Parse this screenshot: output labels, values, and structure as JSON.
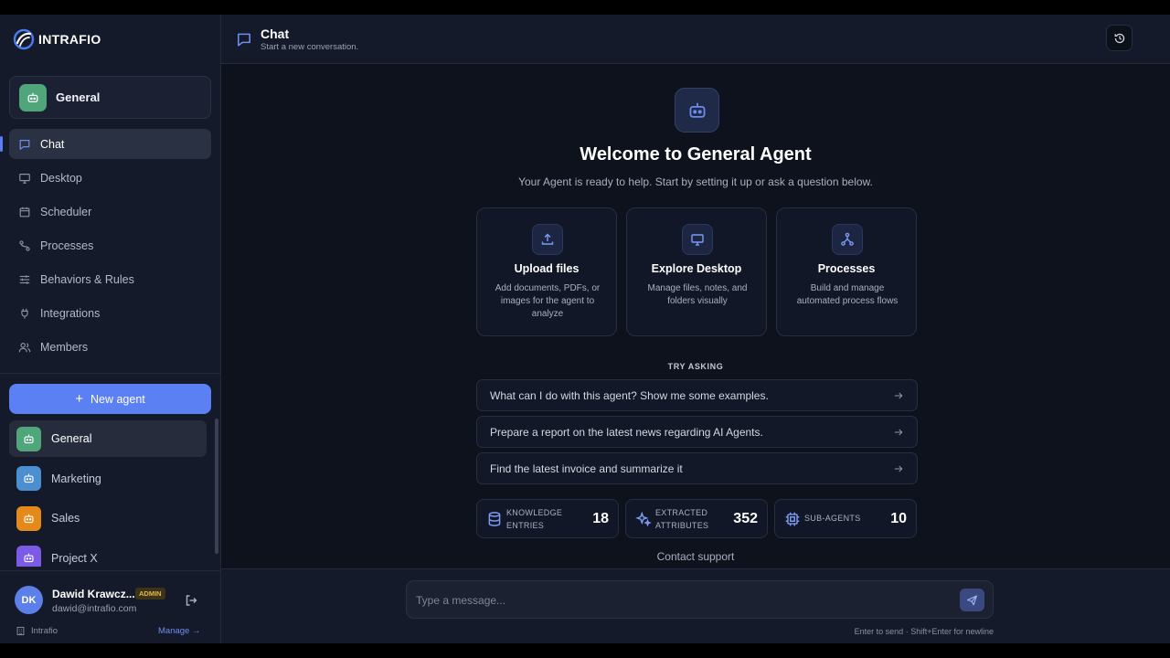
{
  "brand": {
    "name": "INTRAFIO"
  },
  "current_agent": {
    "name": "General"
  },
  "nav": {
    "items": [
      {
        "label": "Chat",
        "icon": "chat-icon",
        "active": true
      },
      {
        "label": "Desktop",
        "icon": "monitor-icon"
      },
      {
        "label": "Scheduler",
        "icon": "calendar-icon"
      },
      {
        "label": "Processes",
        "icon": "workflow-icon"
      },
      {
        "label": "Behaviors & Rules",
        "icon": "sliders-icon"
      },
      {
        "label": "Integrations",
        "icon": "plug-icon"
      },
      {
        "label": "Members",
        "icon": "users-icon"
      }
    ]
  },
  "new_agent_label": "New agent",
  "agents": [
    {
      "name": "General",
      "color": "#4fa67b",
      "active": true
    },
    {
      "name": "Marketing",
      "color": "#4b8fd1"
    },
    {
      "name": "Sales",
      "color": "#e48a1b"
    },
    {
      "name": "Project X",
      "color": "#7b5ae6"
    }
  ],
  "user": {
    "initials": "DK",
    "name": "Dawid Krawcz...",
    "role_badge": "ADMIN",
    "email": "dawid@intrafio.com",
    "org": "Intrafio",
    "manage_label": "Manage →"
  },
  "topbar": {
    "title": "Chat",
    "subtitle": "Start a new conversation."
  },
  "welcome": {
    "title": "Welcome to General Agent",
    "subtitle": "Your Agent is ready to help. Start by setting it up or ask a question below."
  },
  "cards": [
    {
      "title": "Upload files",
      "desc": "Add documents, PDFs, or images for the agent to analyze",
      "icon": "upload-icon"
    },
    {
      "title": "Explore Desktop",
      "desc": "Manage files, notes, and folders visually",
      "icon": "monitor-icon"
    },
    {
      "title": "Processes",
      "desc": "Build and manage automated process flows",
      "icon": "workflow-icon"
    }
  ],
  "try_asking": {
    "heading": "TRY ASKING",
    "items": [
      "What can I do with this agent? Show me some examples.",
      "Prepare a report on the latest news regarding AI Agents.",
      "Find the latest invoice and summarize it"
    ]
  },
  "stats": [
    {
      "label": "KNOWLEDGE ENTRIES",
      "value": "18",
      "icon": "database-icon"
    },
    {
      "label": "EXTRACTED ATTRIBUTES",
      "value": "352",
      "icon": "sparkles-icon"
    },
    {
      "label": "SUB-AGENTS",
      "value": "10",
      "icon": "chip-icon"
    }
  ],
  "contact_label": "Contact support",
  "composer": {
    "placeholder": "Type a message...",
    "hint": "Enter to send · Shift+Enter for newline"
  },
  "colors": {
    "accent": "#5b80f4",
    "background": "#0e121d",
    "sidebar": "#141a29"
  }
}
